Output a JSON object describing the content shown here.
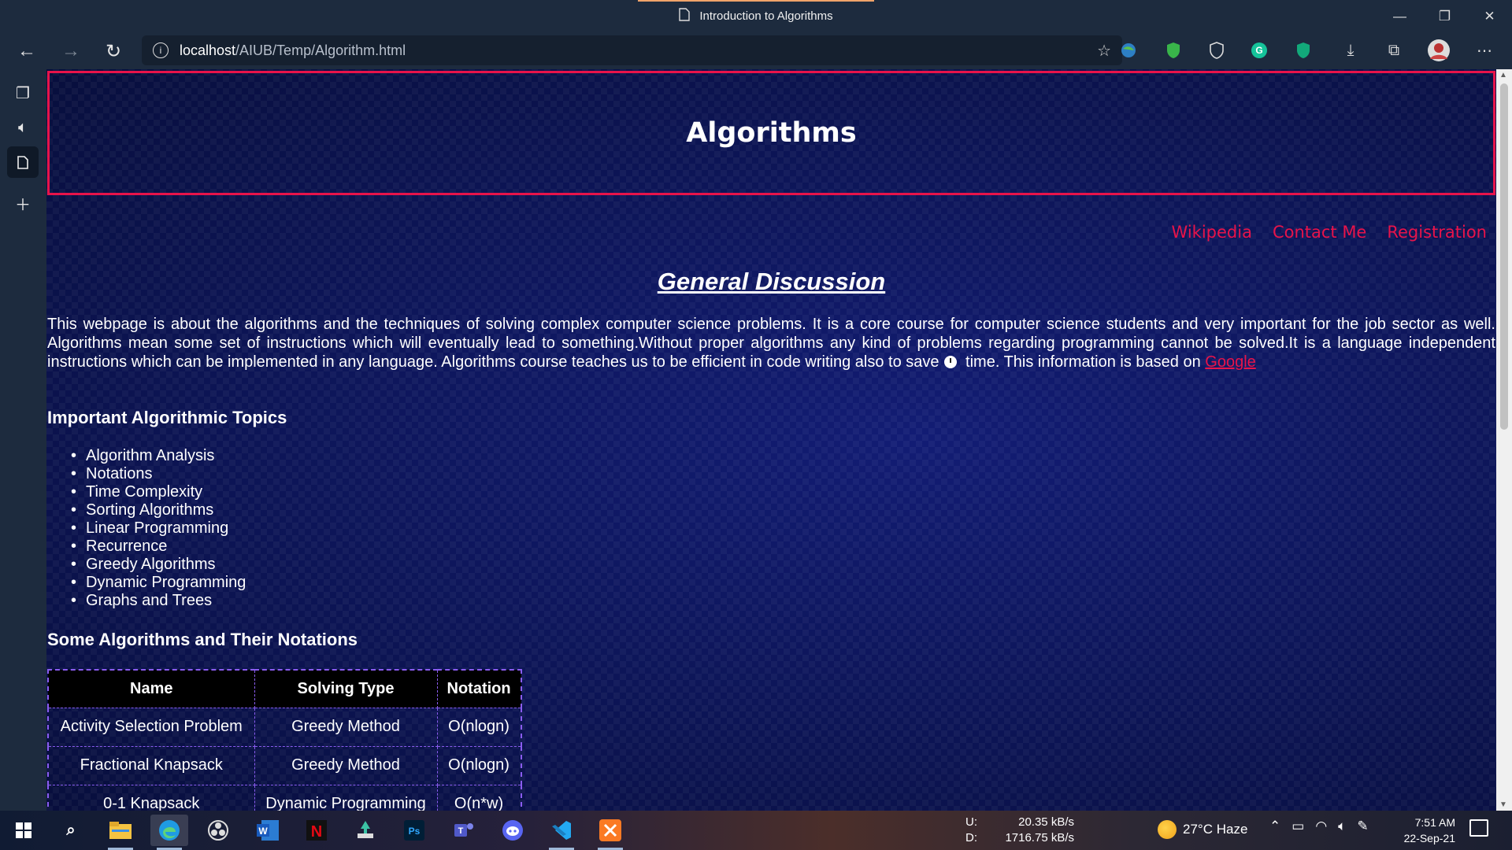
{
  "browser": {
    "tab_title": "Introduction to Algorithms",
    "url_host": "localhost",
    "url_path": "/AIUB/Temp/Algorithm.html",
    "window_controls": {
      "minimize": "—",
      "restore": "❐",
      "close": "✕"
    }
  },
  "page": {
    "header_title": "Algorithms",
    "nav_links": [
      "Wikipedia",
      "Contact Me",
      "Registration"
    ],
    "section_title": "General Discussion",
    "intro_text_before_icon": "This webpage is about the algorithms and the techniques of solving complex computer science problems. It is a core course for computer science students and very important for the job sector as well. Algorithms mean some set of instructions which will eventually lead to something.Without proper algorithms any kind of problems regarding programming cannot be solved.It is a language independent instructions which can be implemented in any language. Algorithms course teaches us to be efficient in code writing also to save",
    "intro_text_after_icon": " time. This information is based on ",
    "intro_link": "Google",
    "topics_heading": "Important Algorithmic Topics",
    "topics": [
      "Algorithm Analysis",
      "Notations",
      "Time Complexity",
      "Sorting Algorithms",
      "Linear Programming",
      "Recurrence",
      "Greedy Algorithms",
      "Dynamic Programming",
      "Graphs and Trees"
    ],
    "table_heading": "Some Algorithms and Their Notations",
    "table": {
      "headers": [
        "Name",
        "Solving Type",
        "Notation"
      ],
      "rows": [
        [
          "Activity Selection Problem",
          "Greedy Method",
          "O(nlogn)"
        ],
        [
          "Fractional Knapsack",
          "Greedy Method",
          "O(nlogn)"
        ],
        [
          "0-1 Knapsack",
          "Dynamic Programming",
          "O(n*w)"
        ]
      ]
    }
  },
  "taskbar": {
    "net_upload_label": "U:",
    "net_upload_value": "20.35 kB/s",
    "net_download_label": "D:",
    "net_download_value": "1716.75 kB/s",
    "weather": "27°C  Haze",
    "time": "7:51 AM",
    "date": "22-Sep-21"
  },
  "colors": {
    "accent_red": "#e8134a",
    "table_border": "#8a5cf0",
    "page_bg": "#0c165d"
  }
}
